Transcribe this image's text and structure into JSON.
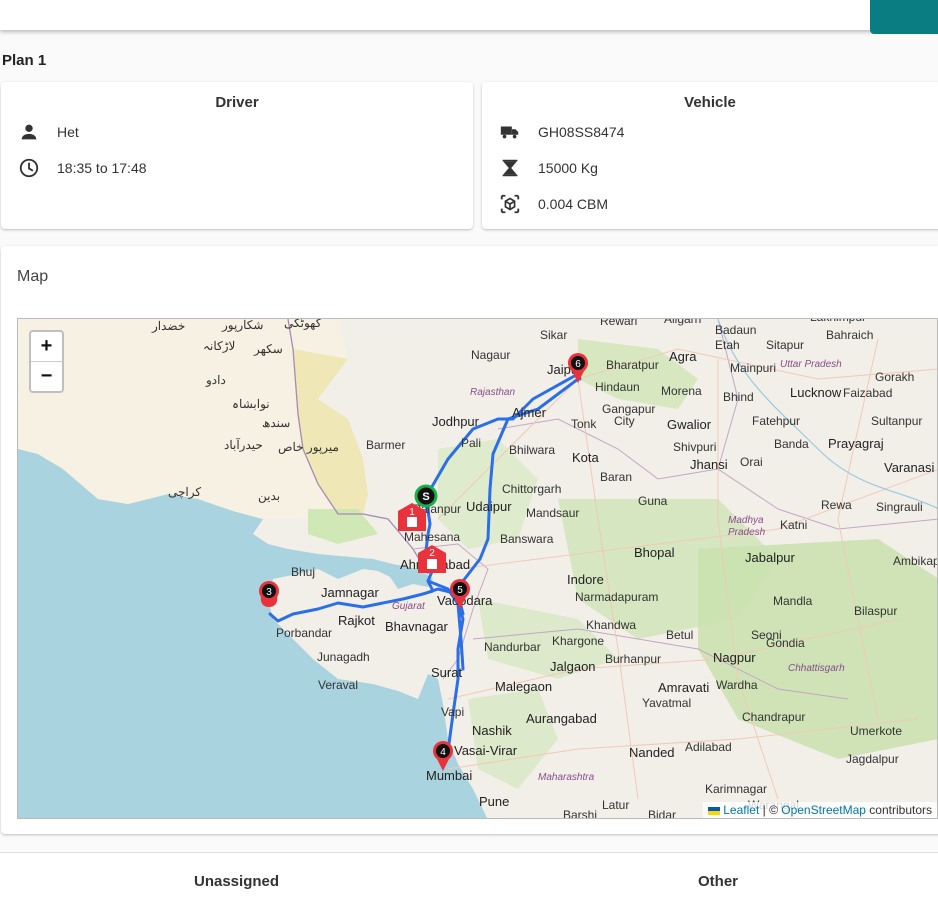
{
  "plan": {
    "title": "Plan 1"
  },
  "driver": {
    "title": "Driver",
    "name": "Het",
    "time": "18:35 to 17:48",
    "name_icon": "person-icon",
    "time_icon": "clock-icon"
  },
  "vehicle": {
    "title": "Vehicle",
    "plate": "GH08SS8474",
    "weight": "15000 Kg",
    "volume": "0.004 CBM",
    "plate_icon": "truck-icon",
    "weight_icon": "weight-icon",
    "volume_icon": "box-icon"
  },
  "map": {
    "title": "Map",
    "zoom_in": "+",
    "zoom_out": "−",
    "attribution": {
      "leaflet": "Leaflet",
      "separator": " | © ",
      "osm": "OpenStreetMap",
      "suffix": " contributors"
    },
    "route_color": "#2a6ee8",
    "marker_color": "#e8323c",
    "start_marker": "S",
    "stops": [
      "1",
      "2",
      "3",
      "4",
      "5",
      "6"
    ],
    "cities": [
      "Rewari",
      "Aligarh",
      "Badaun",
      "Lakhimpur",
      "Bahraich",
      "Sikar",
      "Etah",
      "Sitapur",
      "Nagaur",
      "Bharatpur",
      "Agra",
      "Mainpuri",
      "Uttar Pradesh",
      "Gorakh",
      "Jaipur",
      "Hindaun",
      "Morena",
      "Bhind",
      "Lucknow",
      "Faizabad",
      "Rajasthan",
      "Gangapur City",
      "Jodhpur",
      "Ajmer",
      "Tonk",
      "Gwalior",
      "Fatehpur",
      "Sultanpur",
      "Barmer",
      "Pali",
      "Bhilwara",
      "Shivpuri",
      "Banda",
      "Prayagraj",
      "Kota",
      "Jhansi",
      "Orai",
      "Varanasi",
      "Chittorgarh",
      "Baran",
      "Udaipur",
      "Guna",
      "Rewa",
      "Singrauli",
      "Mandsaur",
      "Madhya Pradesh",
      "Katni",
      "Mahesana",
      "Banswara",
      "Bhopal",
      "Jabalpur",
      "Ahmedabad",
      "Ambikapur",
      "Bhuj",
      "Indore",
      "Narmadapuram",
      "Jamnagar",
      "Vadodara",
      "Gujarat",
      "Rajkot",
      "Bhavnagar",
      "Mandla",
      "Bilaspur",
      "Porbandar",
      "Khandwa",
      "Betul",
      "Seoni",
      "Khargone",
      "Gondia",
      "Junagadh",
      "Nandurbar",
      "Burhanpur",
      "Nagpur",
      "Veraval",
      "Jalgaon",
      "Surat",
      "Chhattisgarh",
      "Amravati",
      "Wardha",
      "Malegaon",
      "Yavatmal",
      "Vapi",
      "Nashik",
      "Aurangabad",
      "Chandrapur",
      "Umerkote",
      "Vasai-Virar",
      "Adilabad",
      "Nanded",
      "Jagdalpur",
      "Mumbai",
      "Maharashtra",
      "Karimnagar",
      "Pune",
      "Latur",
      "Warangal",
      "Barshi",
      "Bidar",
      "Palanpur"
    ],
    "pakistan_labels": [
      "خضدار",
      "شکارپور",
      "گھوٹکی",
      "لاڑکانہ",
      "سکھر",
      "دادو",
      "نوابشاہ",
      "سندھ",
      "حیدرآباد",
      "میرپور خاص",
      "بدین",
      "کراچی"
    ]
  },
  "tabs": {
    "unassigned": "Unassigned",
    "other": "Other"
  }
}
